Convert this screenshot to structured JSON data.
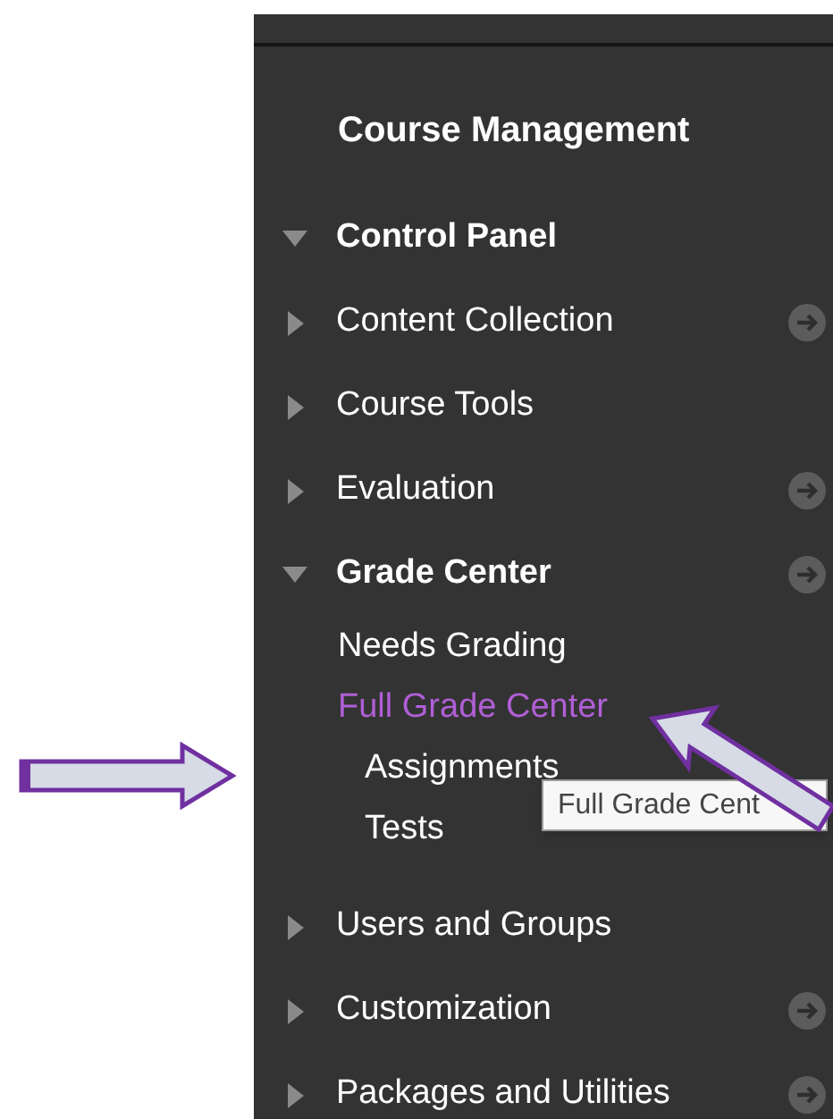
{
  "panel": {
    "title": "Course Management",
    "items": [
      {
        "label": "Control Panel",
        "expanded": true,
        "go": false,
        "children": [
          {
            "label": "Content Collection",
            "expanded": false,
            "go": true
          },
          {
            "label": "Course Tools",
            "expanded": false,
            "go": false
          },
          {
            "label": "Evaluation",
            "expanded": false,
            "go": true
          },
          {
            "label": "Grade Center",
            "expanded": true,
            "go": true,
            "links": [
              {
                "label": "Needs Grading",
                "selected": false
              },
              {
                "label": "Full Grade Center",
                "selected": true,
                "children": [
                  {
                    "label": "Assignments",
                    "selected": false
                  },
                  {
                    "label": "Tests",
                    "selected": false
                  }
                ]
              }
            ]
          },
          {
            "label": "Users and Groups",
            "expanded": false,
            "go": false
          },
          {
            "label": "Customization",
            "expanded": false,
            "go": true
          },
          {
            "label": "Packages and Utilities",
            "expanded": false,
            "go": true
          }
        ]
      }
    ]
  },
  "tooltip": {
    "text": "Full Grade Cent"
  }
}
